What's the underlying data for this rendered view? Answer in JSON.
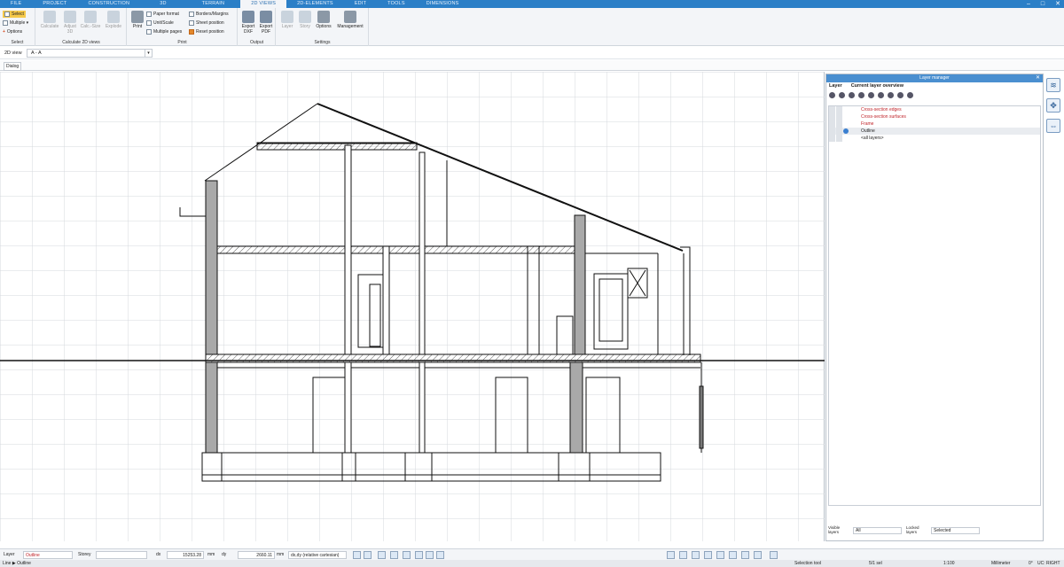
{
  "tabs": [
    "FILE",
    "PROJECT",
    "CONSTRUCTION",
    "3D",
    "TERRAIN",
    "2D VIEWS",
    "2D-ELEMENTS",
    "EDIT",
    "TOOLS",
    "DIMENSIONS"
  ],
  "active_tab": "2D VIEWS",
  "window_controls": {
    "minimize": "–",
    "maximize": "□",
    "close": "✕"
  },
  "ribbon": {
    "select_group": {
      "label": "Select",
      "select": "Select",
      "multiple": "Multiple",
      "options": "Options"
    },
    "calc_group": {
      "label": "Calculate 2D views",
      "calculate": "Calculate",
      "adjust": "Adjust 3D",
      "calc_size": "Calc.-Size",
      "explode": "Explode"
    },
    "print_group": {
      "label": "Print",
      "print": "Print",
      "paper_format": "Paper format",
      "unit_scale": "Unit/Scale",
      "multiple_pages": "Multiple pages",
      "borders_margins": "Borders/Margins",
      "sheet_position": "Sheet position",
      "reset_position": "Reset position"
    },
    "output_group": {
      "label": "Output",
      "export_dxf": "Export DXF",
      "export_pdf": "Export PDF"
    },
    "settings_group": {
      "label": "Settings",
      "layer": "Layer",
      "story": "Story",
      "options": "Options",
      "management": "Management"
    }
  },
  "view_select": {
    "label": "2D view",
    "value": "A - A"
  },
  "dialog_tab": "Dialog",
  "layer_manager": {
    "title": "Layer manager",
    "col_layer": "Layer",
    "col_overview": "Current layer overview",
    "rows": [
      {
        "name": "Cross-section edges",
        "red": true
      },
      {
        "name": "Cross-section surfaces",
        "red": true
      },
      {
        "name": "Frame",
        "red": true
      },
      {
        "name": "Outline",
        "red": false,
        "selected": true
      },
      {
        "name": "<all layers>",
        "red": false
      }
    ],
    "visible_label": "Visible layers",
    "visible_value": "All",
    "locked_label": "Locked layers",
    "locked_value": "Selected"
  },
  "status": {
    "layer_label": "Layer",
    "layer_value": "Outline",
    "storey_label": "Storey",
    "dx_label": "dx",
    "dx_value": "15253.28",
    "unit1": "mm",
    "dy_label": "dy",
    "dy_value": "2660.11",
    "unit2": "mm",
    "mode_value": "dx,dy (relative cartesian)"
  },
  "bottom": {
    "left": "Line ▶ Outline",
    "selection": "Selection tool",
    "ratio": "5/1 sel",
    "scale": "1:100",
    "units": "Millimeter",
    "angle": "0°",
    "uc": "UC: RIGHT"
  },
  "accent_color": "#2b7fc7"
}
